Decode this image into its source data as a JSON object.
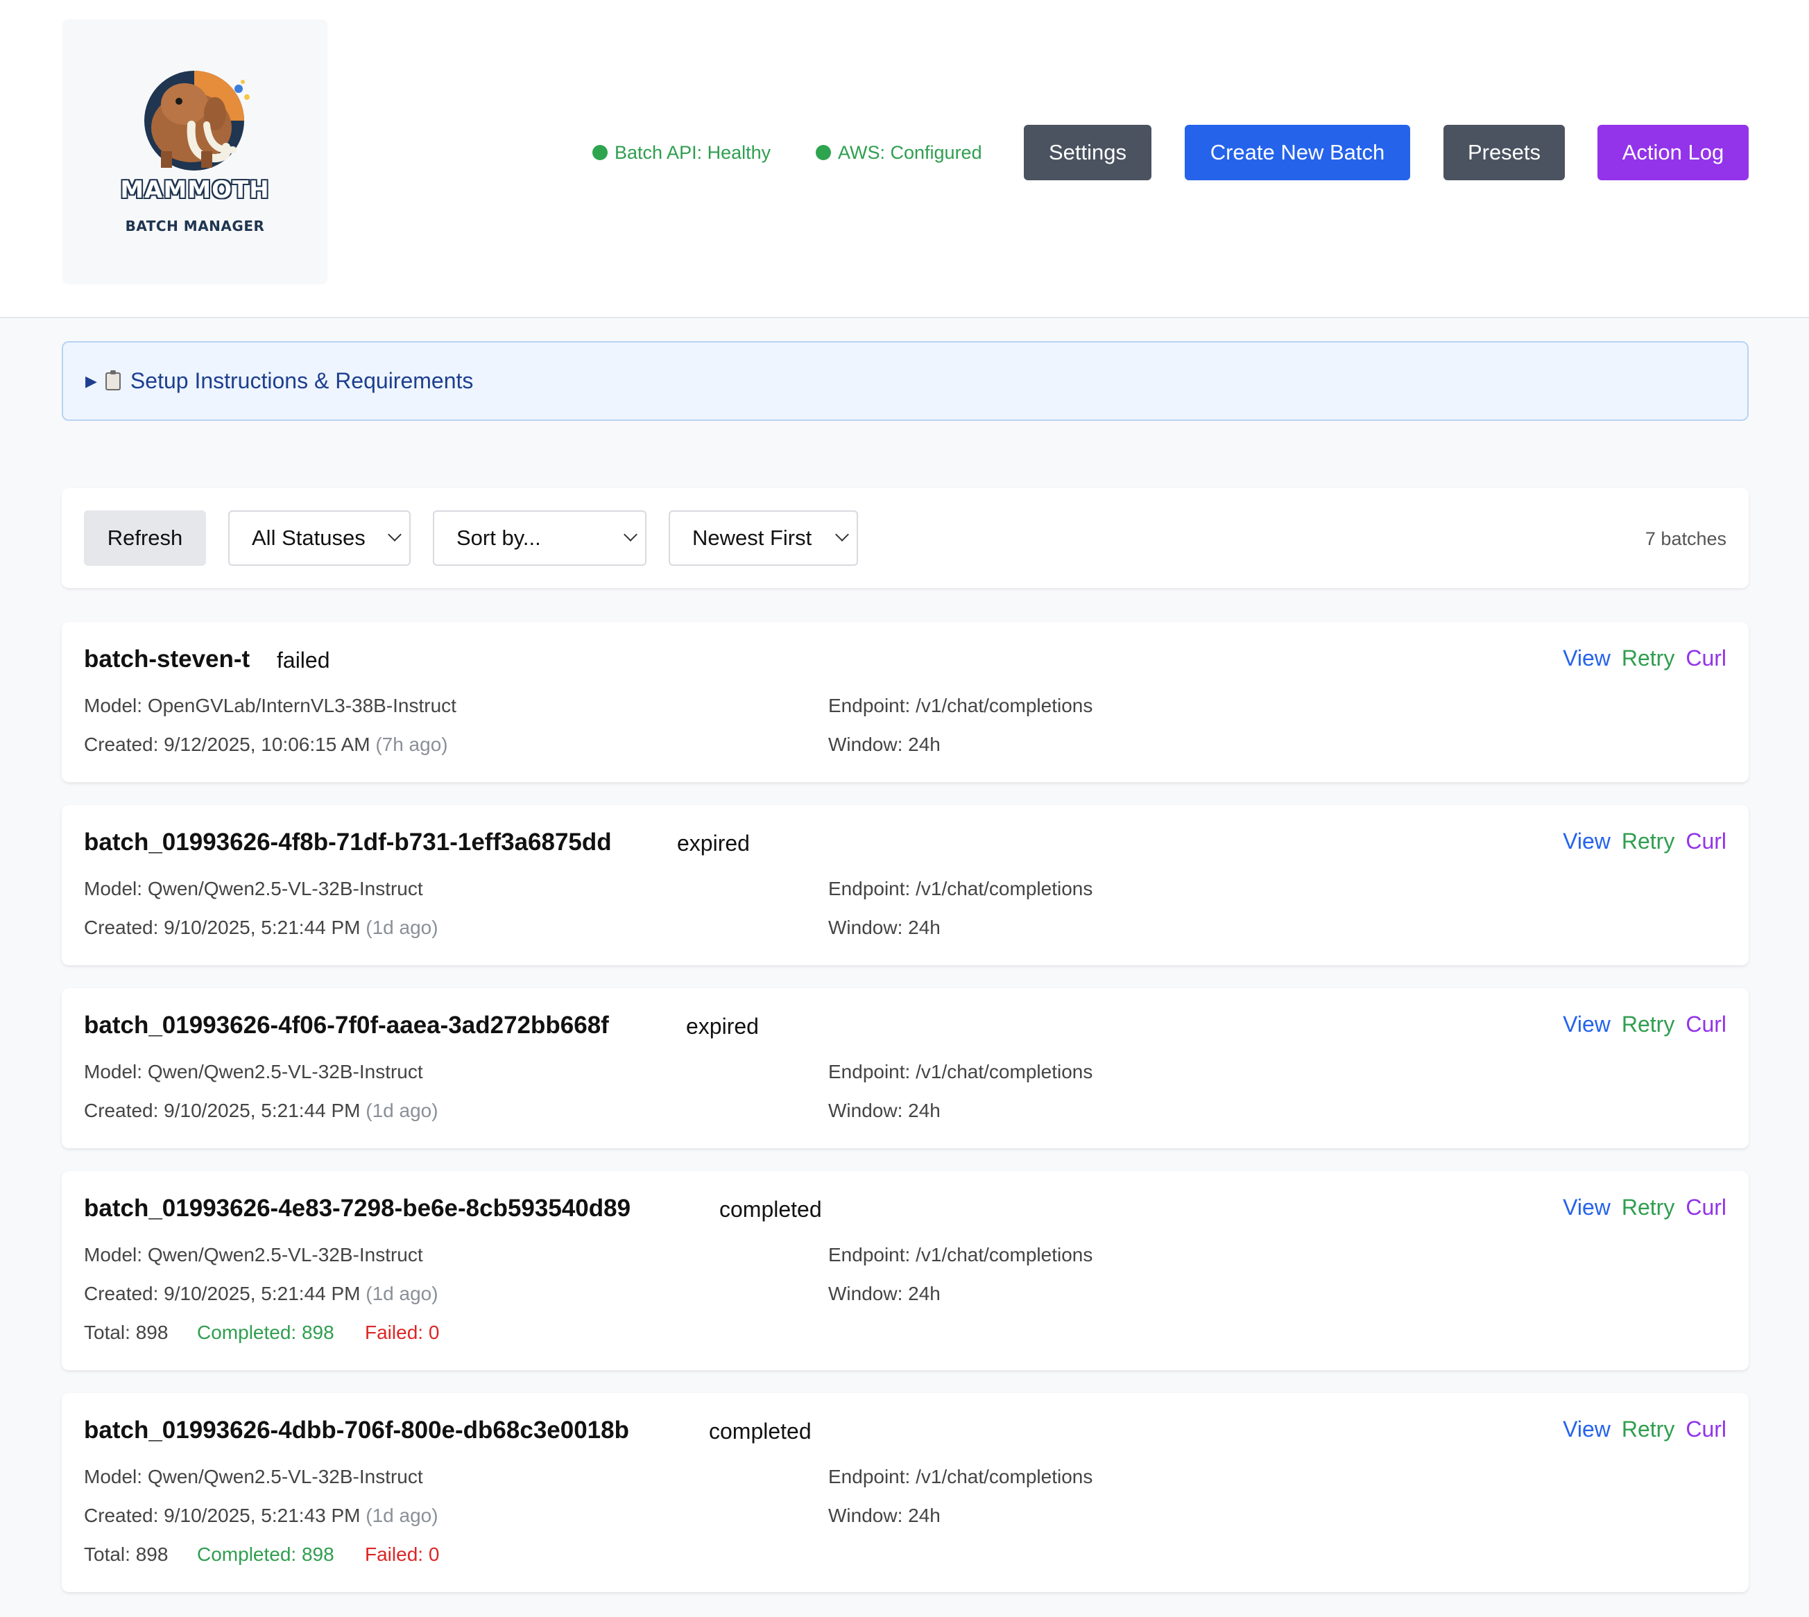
{
  "logo": {
    "title": "MAMMOTH",
    "subtitle": "BATCH MANAGER"
  },
  "header": {
    "status_api": "Batch API: Healthy",
    "status_aws": "AWS: Configured",
    "status_color": "#2ea44f",
    "buttons": {
      "settings": "Settings",
      "create": "Create New Batch",
      "presets": "Presets",
      "action_log": "Action Log"
    }
  },
  "setup": {
    "label": "Setup Instructions & Requirements",
    "expand_icon": "triangle-right-icon",
    "icon": "clipboard-icon"
  },
  "toolbar": {
    "refresh": "Refresh",
    "status_filter": "All Statuses",
    "sort_by": "Sort by...",
    "order": "Newest First",
    "count": "7 batches"
  },
  "actions": {
    "view": "View",
    "retry": "Retry",
    "curl": "Curl"
  },
  "batches": [
    {
      "id": "batch-steven-t",
      "status": "failed",
      "model": "Model: OpenGVLab/InternVL3-38B-Instruct",
      "endpoint": "Endpoint: /v1/chat/completions",
      "created": "Created: 9/12/2025, 10:06:15 AM",
      "ago": "(7h ago)",
      "window": "Window: 24h"
    },
    {
      "id": "batch_01993626-4f8b-71df-b731-1eff3a6875dd",
      "status": "expired",
      "model": "Model: Qwen/Qwen2.5-VL-32B-Instruct",
      "endpoint": "Endpoint: /v1/chat/completions",
      "created": "Created: 9/10/2025, 5:21:44 PM",
      "ago": "(1d ago)",
      "window": "Window: 24h"
    },
    {
      "id": "batch_01993626-4f06-7f0f-aaea-3ad272bb668f",
      "status": "expired",
      "model": "Model: Qwen/Qwen2.5-VL-32B-Instruct",
      "endpoint": "Endpoint: /v1/chat/completions",
      "created": "Created: 9/10/2025, 5:21:44 PM",
      "ago": "(1d ago)",
      "window": "Window: 24h"
    },
    {
      "id": "batch_01993626-4e83-7298-be6e-8cb593540d89",
      "status": "completed",
      "model": "Model: Qwen/Qwen2.5-VL-32B-Instruct",
      "endpoint": "Endpoint: /v1/chat/completions",
      "created": "Created: 9/10/2025, 5:21:44 PM",
      "ago": "(1d ago)",
      "window": "Window: 24h",
      "total": "Total: 898",
      "completed": "Completed: 898",
      "failed": "Failed: 0"
    },
    {
      "id": "batch_01993626-4dbb-706f-800e-db68c3e0018b",
      "status": "completed",
      "model": "Model: Qwen/Qwen2.5-VL-32B-Instruct",
      "endpoint": "Endpoint: /v1/chat/completions",
      "created": "Created: 9/10/2025, 5:21:43 PM",
      "ago": "(1d ago)",
      "window": "Window: 24h",
      "total": "Total: 898",
      "completed": "Completed: 898",
      "failed": "Failed: 0"
    }
  ],
  "colors": {
    "accent_blue": "#2563eb",
    "accent_purple": "#9333ea",
    "button_gray": "#4b5360",
    "success_green": "#2f9e4f",
    "error_red": "#dc2626"
  }
}
